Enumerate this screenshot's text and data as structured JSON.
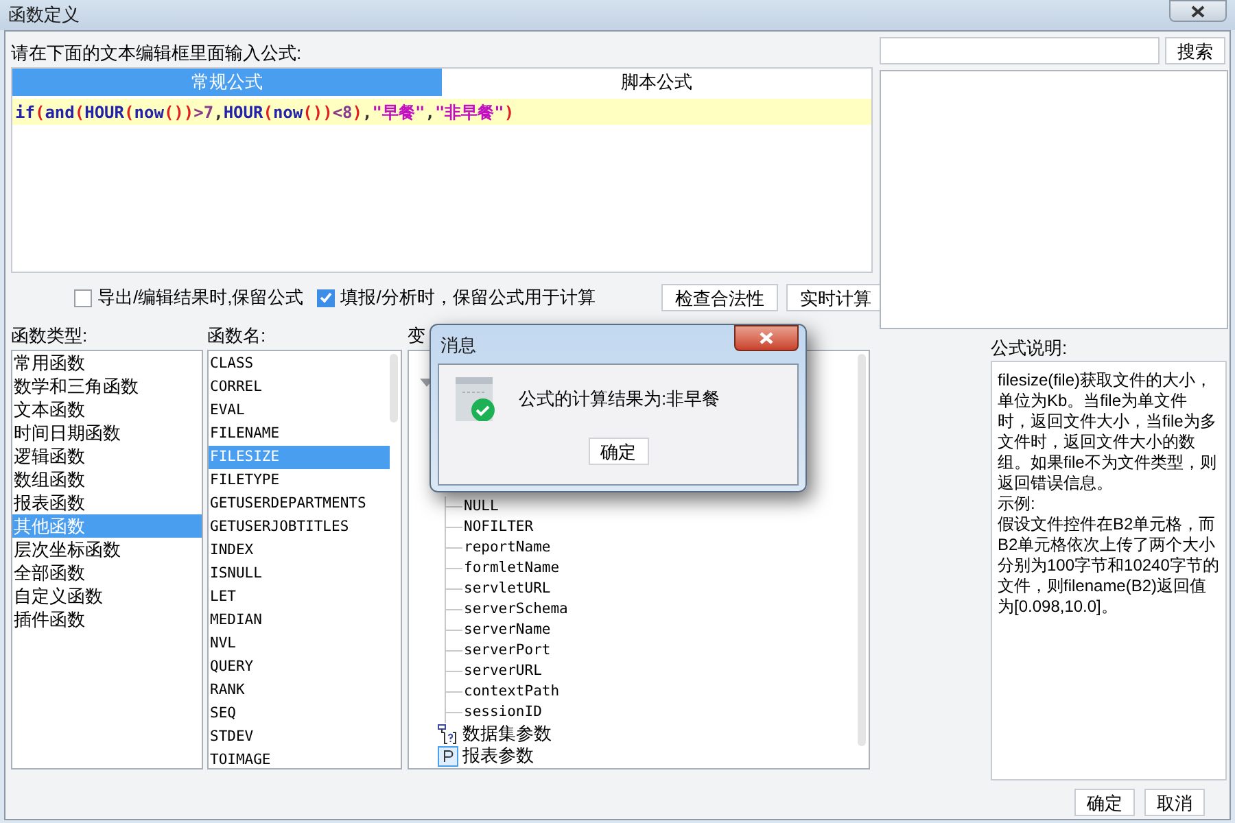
{
  "window": {
    "title": "函数定义"
  },
  "prompt": "请在下面的文本编辑框里面输入公式:",
  "tabs": [
    {
      "label": "常规公式",
      "selected": true
    },
    {
      "label": "脚本公式",
      "selected": false
    }
  ],
  "formula": {
    "tokens": [
      {
        "kind": "func",
        "text": "if"
      },
      {
        "kind": "paren",
        "text": "("
      },
      {
        "kind": "func",
        "text": "and"
      },
      {
        "kind": "paren",
        "text": "("
      },
      {
        "kind": "func",
        "text": "HOUR"
      },
      {
        "kind": "paren",
        "text": "("
      },
      {
        "kind": "func",
        "text": "now"
      },
      {
        "kind": "paren",
        "text": "())"
      },
      {
        "kind": "op",
        "text": ">7"
      },
      {
        "kind": "comma",
        "text": ","
      },
      {
        "kind": "func",
        "text": "HOUR"
      },
      {
        "kind": "paren",
        "text": "("
      },
      {
        "kind": "func",
        "text": "now"
      },
      {
        "kind": "paren",
        "text": "())"
      },
      {
        "kind": "op",
        "text": "<8"
      },
      {
        "kind": "paren",
        "text": ")"
      },
      {
        "kind": "comma",
        "text": ","
      },
      {
        "kind": "string",
        "text": "\"早餐\""
      },
      {
        "kind": "comma",
        "text": ","
      },
      {
        "kind": "string",
        "text": "\"非早餐\""
      },
      {
        "kind": "paren",
        "text": ")"
      }
    ]
  },
  "options": [
    {
      "label": "导出/编辑结果时,保留公式",
      "checked": false
    },
    {
      "label": "填报/分析时，保留公式用于计算",
      "checked": true
    }
  ],
  "actions": [
    "检查合法性",
    "实时计算"
  ],
  "search": {
    "button": "搜索"
  },
  "function_types": {
    "label": "函数类型:",
    "items": [
      {
        "label": "常用函数",
        "selected": false
      },
      {
        "label": "数学和三角函数",
        "selected": false
      },
      {
        "label": "文本函数",
        "selected": false
      },
      {
        "label": "时间日期函数",
        "selected": false
      },
      {
        "label": "逻辑函数",
        "selected": false
      },
      {
        "label": "数组函数",
        "selected": false
      },
      {
        "label": "报表函数",
        "selected": false
      },
      {
        "label": "其他函数",
        "selected": true
      },
      {
        "label": "层次坐标函数",
        "selected": false
      },
      {
        "label": "全部函数",
        "selected": false
      },
      {
        "label": "自定义函数",
        "selected": false
      },
      {
        "label": "插件函数",
        "selected": false
      }
    ]
  },
  "function_names": {
    "label": "函数名:",
    "items": [
      {
        "label": "CLASS",
        "selected": false
      },
      {
        "label": "CORREL",
        "selected": false
      },
      {
        "label": "EVAL",
        "selected": false
      },
      {
        "label": "FILENAME",
        "selected": false
      },
      {
        "label": "FILESIZE",
        "selected": true
      },
      {
        "label": "FILETYPE",
        "selected": false
      },
      {
        "label": "GETUSERDEPARTMENTS",
        "selected": false
      },
      {
        "label": "GETUSERJOBTITLES",
        "selected": false
      },
      {
        "label": "INDEX",
        "selected": false
      },
      {
        "label": "ISNULL",
        "selected": false
      },
      {
        "label": "LET",
        "selected": false
      },
      {
        "label": "MEDIAN",
        "selected": false
      },
      {
        "label": "NVL",
        "selected": false
      },
      {
        "label": "QUERY",
        "selected": false
      },
      {
        "label": "RANK",
        "selected": false
      },
      {
        "label": "SEQ",
        "selected": false
      },
      {
        "label": "STDEV",
        "selected": false
      },
      {
        "label": "TOIMAGE",
        "selected": false
      }
    ]
  },
  "variables": {
    "label": "变",
    "tree": [
      {
        "kind": "folder",
        "expanded": true,
        "children": [
          {
            "label": "NULL"
          },
          {
            "label": "NOFILTER"
          },
          {
            "label": "reportName"
          },
          {
            "label": "formletName"
          },
          {
            "label": "servletURL"
          },
          {
            "label": "serverSchema"
          },
          {
            "label": "serverName"
          },
          {
            "label": "serverPort"
          },
          {
            "label": "serverURL"
          },
          {
            "label": "contextPath"
          },
          {
            "label": "sessionID"
          }
        ]
      },
      {
        "kind": "dataset",
        "label": "数据集参数"
      },
      {
        "kind": "param",
        "label": "报表参数"
      }
    ]
  },
  "description": {
    "label": "公式说明:",
    "paragraphs": [
      "filesize(file)获取文件的大小，单位为Kb。当file为单文件时，返回文件大小，当file为多文件时，返回文件大小的数组。如果file不为文件类型，则返回错误信息。",
      "示例:",
      "假设文件控件在B2单元格，而B2单元格依次上传了两个大小分别为100字节和10240字节的文件，则filename(B2)返回值为[0.098,10.0]。"
    ]
  },
  "buttons": [
    "确定",
    "取消"
  ],
  "message": {
    "title": "消息",
    "text": "公式的计算结果为:非早餐",
    "button": "确定"
  }
}
